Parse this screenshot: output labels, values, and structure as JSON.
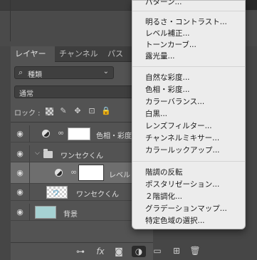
{
  "panel": {
    "tabs": [
      "レイヤー",
      "チャンネル",
      "パス"
    ],
    "filter": {
      "icon": "search-icon",
      "value": "種類"
    },
    "blend_mode": "通常",
    "lock_label": "ロック :",
    "layers": [
      {
        "name": "色相・彩度",
        "type": "adjustment"
      },
      {
        "name": "ワンセクくん",
        "type": "group"
      },
      {
        "name": "レベル",
        "type": "adjustment",
        "selected": true
      },
      {
        "name": "ワンセクくん",
        "type": "pixel",
        "thumb_text": "ワ"
      },
      {
        "name": "背景",
        "type": "background",
        "color": "#a6d2d3"
      }
    ],
    "bottom_icons": [
      "link-icon",
      "fx-icon",
      "mask-icon",
      "adjustment-icon",
      "folder-icon",
      "new-layer-icon",
      "trash-icon"
    ],
    "fx_label": "fx"
  },
  "menu": {
    "cut_top": "パターン...",
    "groups": [
      [
        "明るさ・コントラスト...",
        "レベル補正...",
        "トーンカーブ...",
        "露光量..."
      ],
      [
        "自然な彩度...",
        "色相・彩度...",
        "カラーバランス...",
        "白黒...",
        "レンズフィルター...",
        "チャンネルミキサー...",
        "カラールックアップ..."
      ],
      [
        "階調の反転",
        "ポスタリゼーション...",
        "２階調化...",
        "グラデーションマップ...",
        "特定色域の選択..."
      ]
    ]
  }
}
